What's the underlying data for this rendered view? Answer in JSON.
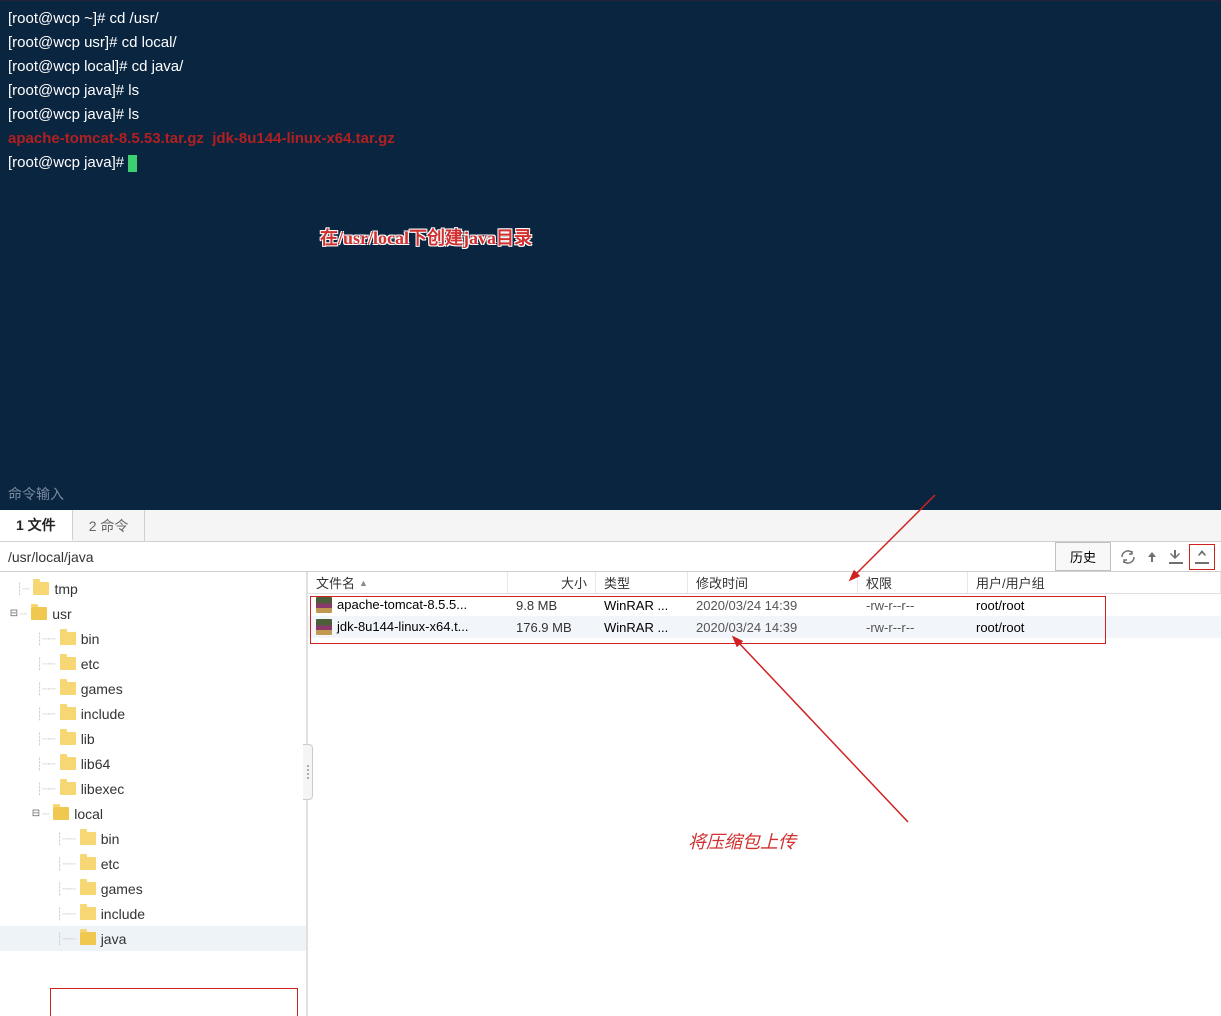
{
  "terminal": {
    "lines": [
      "[root@wcp ~]# cd /usr/",
      "[root@wcp usr]# cd local/",
      "[root@wcp local]# cd java/",
      "[root@wcp java]# ls",
      "[root@wcp java]# ls"
    ],
    "ls_output": "apache-tomcat-8.5.53.tar.gz  jdk-8u144-linux-x64.tar.gz",
    "prompt_after": "[root@wcp java]# ",
    "annotation": "在/usr/local下创建java目录",
    "input_label": "命令输入"
  },
  "tabs": {
    "file": "1 文件",
    "cmd": "2 命令"
  },
  "path": "/usr/local/java",
  "history_btn": "历史",
  "file_columns": {
    "name": "文件名",
    "size": "大小",
    "type": "类型",
    "date": "修改时间",
    "perm": "权限",
    "user": "用户/用户组"
  },
  "files": [
    {
      "name": "apache-tomcat-8.5.5...",
      "size": "9.8 MB",
      "type": "WinRAR ...",
      "date": "2020/03/24 14:39",
      "perm": "-rw-r--r--",
      "user": "root/root"
    },
    {
      "name": "jdk-8u144-linux-x64.t...",
      "size": "176.9 MB",
      "type": "WinRAR ...",
      "date": "2020/03/24 14:39",
      "perm": "-rw-r--r--",
      "user": "root/root"
    }
  ],
  "tree": {
    "tmp": "tmp",
    "usr": "usr",
    "usr_children": [
      "bin",
      "etc",
      "games",
      "include",
      "lib",
      "lib64",
      "libexec"
    ],
    "local": "local",
    "local_children": [
      "bin",
      "etc",
      "games",
      "include",
      "java"
    ]
  },
  "annotation2": "将压缩包上传"
}
